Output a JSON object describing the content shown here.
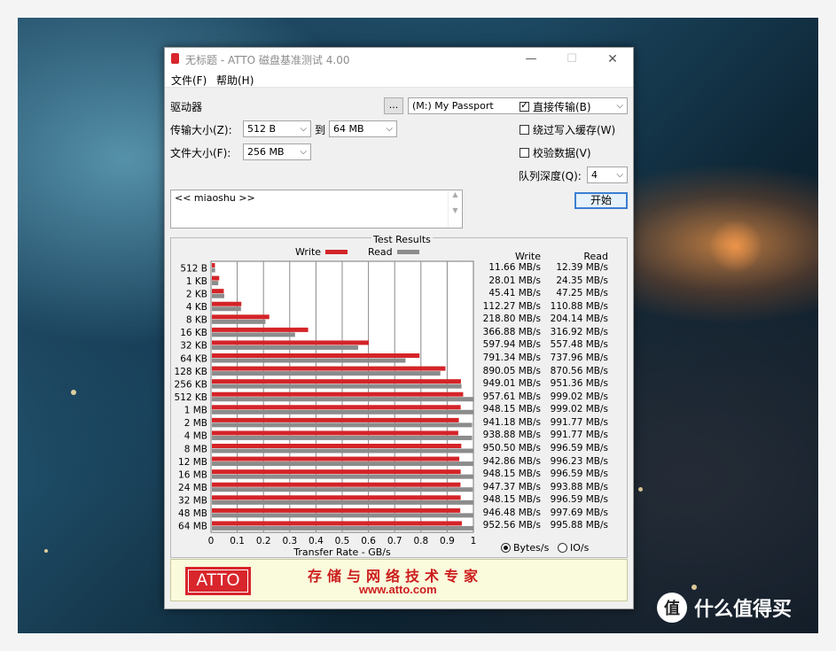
{
  "window": {
    "title": "无标题 - ATTO 磁盘基准测试 4.00",
    "controls": {
      "minimize": "—",
      "maximize": "☐",
      "close": "✕"
    }
  },
  "menu": [
    "文件(F)",
    "帮助(H)"
  ],
  "settings": {
    "drive_label": "驱动器",
    "browse_label": "...",
    "drive_value": "(M:) My Passport",
    "transfer_label": "传输大小(Z):",
    "transfer_from": "512 B",
    "to_label": "到",
    "transfer_to": "64 MB",
    "filesize_label": "文件大小(F):",
    "filesize_value": "256 MB",
    "direct_io": {
      "label": "直接传输(B)",
      "checked": true
    },
    "bypass_write_cache": {
      "label": "绕过写入缓存(W)",
      "checked": false
    },
    "verify_data": {
      "label": "校验数据(V)",
      "checked": false
    },
    "queue_depth_label": "队列深度(Q):",
    "queue_depth_value": "4",
    "start_button": "开始",
    "description": "<< miaoshu >>"
  },
  "results": {
    "title": "Test Results",
    "write_label": "Write",
    "read_label": "Read",
    "col_write": "Write",
    "col_read": "Read",
    "unit_bytes": "Bytes/s",
    "unit_io": "IO/s",
    "selected_unit": "Bytes/s",
    "rows": [
      {
        "size": "512 B",
        "write": "11.66 MB/s",
        "read": "12.39 MB/s"
      },
      {
        "size": "1 KB",
        "write": "28.01 MB/s",
        "read": "24.35 MB/s"
      },
      {
        "size": "2 KB",
        "write": "45.41 MB/s",
        "read": "47.25 MB/s"
      },
      {
        "size": "4 KB",
        "write": "112.27 MB/s",
        "read": "110.88 MB/s"
      },
      {
        "size": "8 KB",
        "write": "218.80 MB/s",
        "read": "204.14 MB/s"
      },
      {
        "size": "16 KB",
        "write": "366.88 MB/s",
        "read": "316.92 MB/s"
      },
      {
        "size": "32 KB",
        "write": "597.94 MB/s",
        "read": "557.48 MB/s"
      },
      {
        "size": "64 KB",
        "write": "791.34 MB/s",
        "read": "737.96 MB/s"
      },
      {
        "size": "128 KB",
        "write": "890.05 MB/s",
        "read": "870.56 MB/s"
      },
      {
        "size": "256 KB",
        "write": "949.01 MB/s",
        "read": "951.36 MB/s"
      },
      {
        "size": "512 KB",
        "write": "957.61 MB/s",
        "read": "999.02 MB/s"
      },
      {
        "size": "1 MB",
        "write": "948.15 MB/s",
        "read": "999.02 MB/s"
      },
      {
        "size": "2 MB",
        "write": "941.18 MB/s",
        "read": "991.77 MB/s"
      },
      {
        "size": "4 MB",
        "write": "938.88 MB/s",
        "read": "991.77 MB/s"
      },
      {
        "size": "8 MB",
        "write": "950.50 MB/s",
        "read": "996.59 MB/s"
      },
      {
        "size": "12 MB",
        "write": "942.86 MB/s",
        "read": "996.23 MB/s"
      },
      {
        "size": "16 MB",
        "write": "948.15 MB/s",
        "read": "996.59 MB/s"
      },
      {
        "size": "24 MB",
        "write": "947.37 MB/s",
        "read": "993.88 MB/s"
      },
      {
        "size": "32 MB",
        "write": "948.15 MB/s",
        "read": "996.59 MB/s"
      },
      {
        "size": "48 MB",
        "write": "946.48 MB/s",
        "read": "997.69 MB/s"
      },
      {
        "size": "64 MB",
        "write": "952.56 MB/s",
        "read": "995.88 MB/s"
      }
    ]
  },
  "chart_data": {
    "type": "bar",
    "orientation": "horizontal",
    "xlabel": "Transfer Rate - GB/s",
    "xlim": [
      0,
      1
    ],
    "xticks": [
      "0",
      "0.1",
      "0.2",
      "0.3",
      "0.4",
      "0.5",
      "0.6",
      "0.7",
      "0.8",
      "0.9",
      "1"
    ],
    "categories": [
      "512 B",
      "1 KB",
      "2 KB",
      "4 KB",
      "8 KB",
      "16 KB",
      "32 KB",
      "64 KB",
      "128 KB",
      "256 KB",
      "512 KB",
      "1 MB",
      "2 MB",
      "4 MB",
      "8 MB",
      "12 MB",
      "16 MB",
      "24 MB",
      "32 MB",
      "48 MB",
      "64 MB"
    ],
    "series": [
      {
        "name": "Write",
        "color": "#d42428",
        "values": [
          0.01166,
          0.02801,
          0.04541,
          0.11227,
          0.2188,
          0.36688,
          0.59794,
          0.79134,
          0.89005,
          0.94901,
          0.95761,
          0.94815,
          0.94118,
          0.93888,
          0.9505,
          0.94286,
          0.94815,
          0.94737,
          0.94815,
          0.94648,
          0.95256
        ]
      },
      {
        "name": "Read",
        "color": "#8c8c8c",
        "values": [
          0.01239,
          0.02435,
          0.04725,
          0.11088,
          0.20414,
          0.31692,
          0.55748,
          0.73796,
          0.87056,
          0.95136,
          0.99902,
          0.99902,
          0.99177,
          0.99177,
          0.99659,
          0.99623,
          0.99659,
          0.99388,
          0.99659,
          0.99769,
          0.99588
        ]
      }
    ],
    "grid": true
  },
  "banner": {
    "logo": "ATTO",
    "slogan": "存储与网络技术专家",
    "url": "www.atto.com"
  },
  "watermark": {
    "logo_glyph": "值",
    "text": "什么值得买"
  }
}
